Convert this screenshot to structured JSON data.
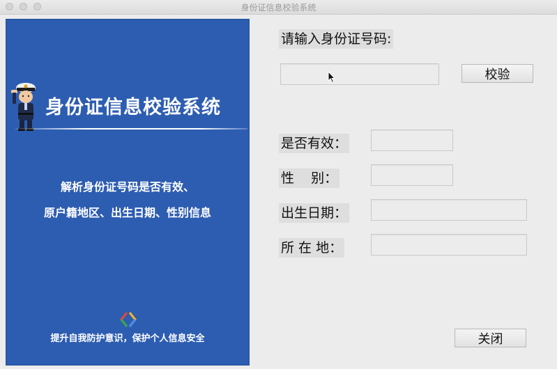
{
  "window": {
    "title": "身份证信息校验系统"
  },
  "banner": {
    "title": "身份证信息校验系统",
    "description_line1": "解析身份证号码是否有效、",
    "description_line2": "原户籍地区、出生日期、性别信息",
    "footer": "提升自我防护意识，保护个人信息安全",
    "background_color": "#2d5db1"
  },
  "form": {
    "id_prompt": "请输入身份证号码:",
    "id_value": "",
    "check_button": "校验",
    "valid_label": "是否有效：",
    "valid_value": "",
    "gender_label": "性    别：",
    "gender_value": "",
    "birth_label": "出生日期：",
    "birth_value": "",
    "location_label": "所 在 地：",
    "location_value": "",
    "close_button": "关闭"
  },
  "icons": [
    "police-officer-icon",
    "app-logo-icon",
    "mouse-cursor-icon"
  ]
}
